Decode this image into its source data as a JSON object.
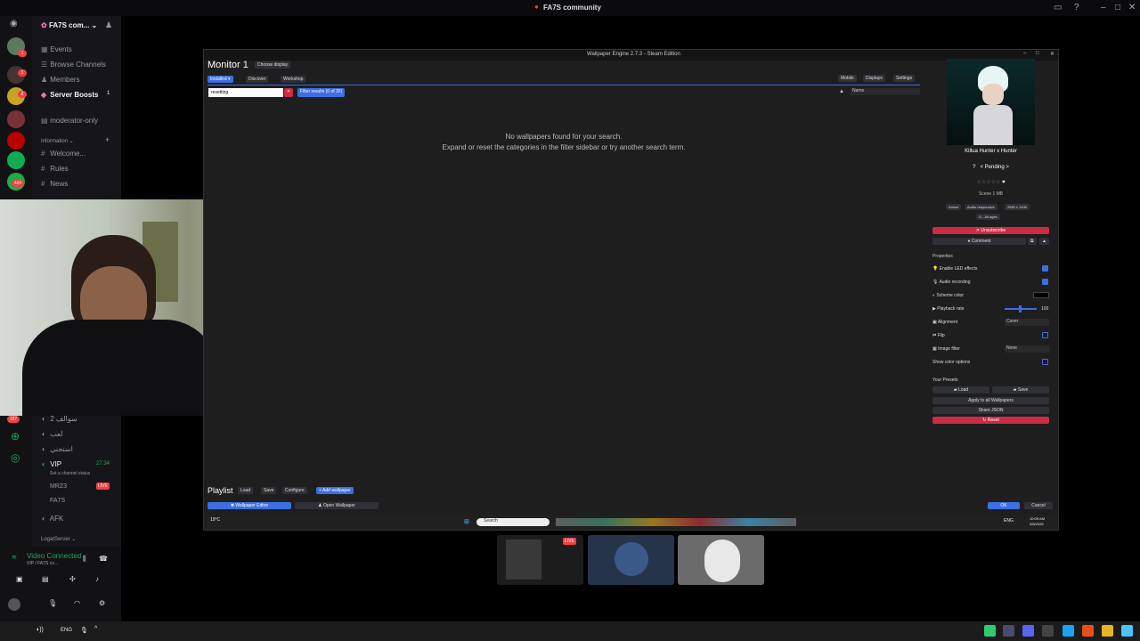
{
  "titlebar": {
    "title": "FA7S community"
  },
  "server": {
    "name": "FA7S com..."
  },
  "channels": {
    "events": "Events",
    "browse": "Browse Channels",
    "members": "Members",
    "boosts": "Server Boosts",
    "boosts_count": "1",
    "moderator": "moderator-only",
    "category": "Information",
    "welcome": "Welcome...",
    "rules": "Rules",
    "news": "News",
    "voice1": "2 ﺳﻮاﻟﻒ",
    "voice2": "ﻟﻌﺐ",
    "voice3": "ﺍﺳﺘﺠﻨﻲ",
    "vip": "VIP",
    "vip_time": "27:34",
    "status": "Set a channel status",
    "user1": "MRZ3",
    "live": "LIVE",
    "user2": "FA7S",
    "afk": "AFK",
    "logs": "LogatServer"
  },
  "rail_badges": [
    "1",
    "1",
    "2",
    "484",
    "187"
  ],
  "voice_connected": {
    "title": "Video Connected",
    "sub": "VIP / FA7S co..."
  },
  "wallpaper_engine": {
    "window_title": "Wallpaper Engine 2.7.3 - Steam Edition",
    "monitor": "Monitor 1",
    "choose_display": "Choose display",
    "tabs": [
      "Installed",
      "Discover",
      "Workshop"
    ],
    "right_tabs": [
      "Mobile",
      "Displays",
      "Settings"
    ],
    "search_value": "resetting",
    "filter_btn": "Filter results (0 of 35)",
    "sort": "Name",
    "empty_line1": "No wallpapers found for your search.",
    "empty_line2": "Expand or reset the categories in the filter sidebar or try another search term.",
    "preview": {
      "name": "Killua Hunter x Hunter",
      "status": "< Pending >",
      "type": "Scene 1 MB",
      "tags": [
        "Anime",
        "Audio responsive",
        "2560 x 1440"
      ],
      "rating": "G - All ages",
      "unsubscribe": "Unsubscribe",
      "comment": "Comment"
    },
    "properties_title": "Properties",
    "properties": [
      {
        "label": "Enable LED effects",
        "kind": "check",
        "on": true
      },
      {
        "label": "Audio recording",
        "kind": "check",
        "on": true
      },
      {
        "label": "Scheme color",
        "kind": "color"
      },
      {
        "label": "Playback rate",
        "kind": "slider",
        "value": "100",
        "level": 1.0
      },
      {
        "label": "Alignment",
        "kind": "select",
        "value": "Cover"
      },
      {
        "label": "Flip",
        "kind": "check",
        "on": false
      },
      {
        "label": "Image filter",
        "kind": "select",
        "value": "None"
      },
      {
        "label": "Show color options",
        "kind": "check",
        "on": false
      }
    ],
    "presets_title": "Your Presets",
    "load": "Load",
    "save": "Save",
    "apply_all": "Apply to all Wallpapers",
    "share_json": "Share JSON",
    "reset": "Reset",
    "playlist": "Playlist",
    "pl_load": "Load",
    "pl_save": "Save",
    "pl_configure": "Configure",
    "pl_add": "Add wallpaper",
    "editor": "Wallpaper Editor",
    "open": "Open Wallpaper",
    "ok": "OK",
    "cancel": "Cancel"
  },
  "inner_taskbar": {
    "weather": "19°C",
    "search": "Search",
    "lang": "ENG",
    "time": "10:09 AM",
    "date": "3/8/2026"
  },
  "os_taskbar": {
    "lang": "ENG"
  }
}
